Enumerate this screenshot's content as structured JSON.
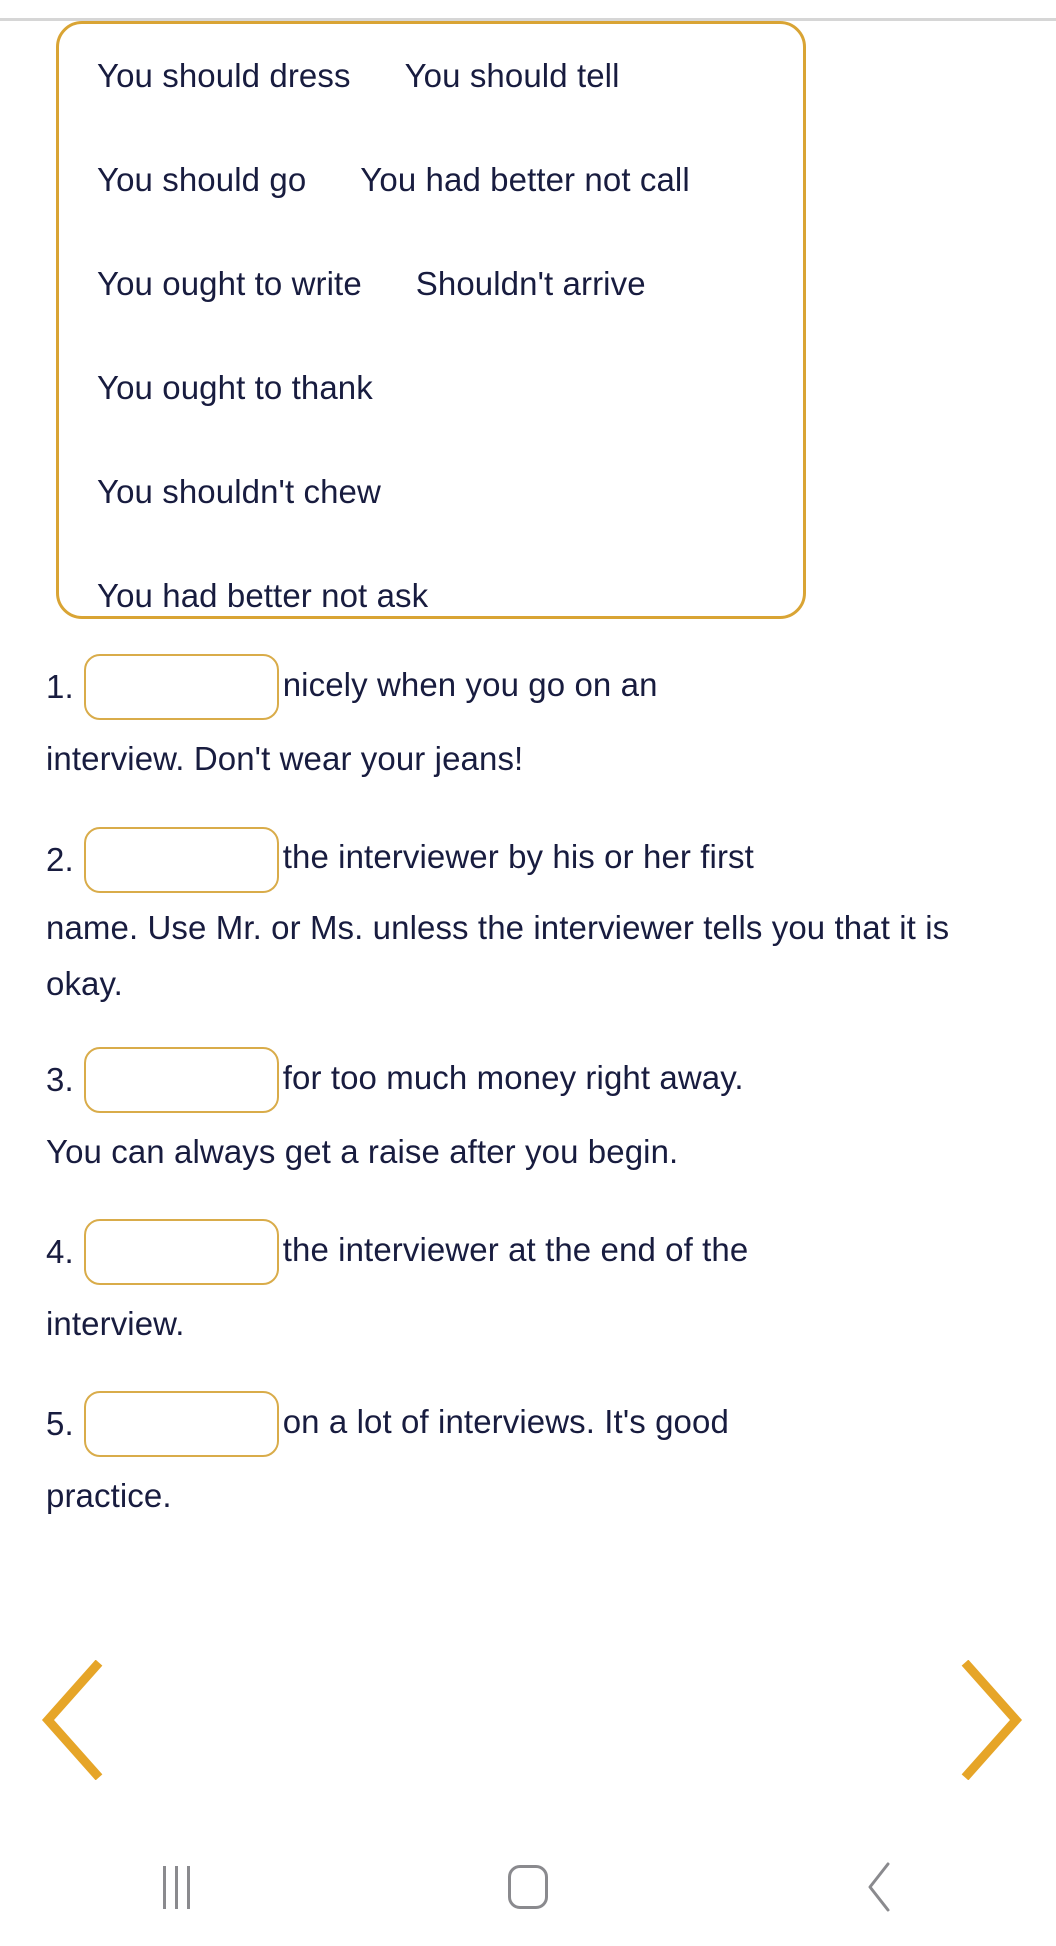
{
  "word_bank": {
    "rows": [
      [
        "You should dress",
        "You should tell"
      ],
      [
        "You should go",
        "You had better not call"
      ],
      [
        "You ought to write",
        "Shouldn't arrive"
      ],
      [
        "You ought to thank"
      ],
      [
        "You shouldn't chew"
      ],
      [
        "You had better not ask"
      ]
    ]
  },
  "questions": [
    {
      "number": "1.",
      "after_blank": "nicely when you go on an",
      "tail": "interview. Don't wear your jeans!",
      "blank_value": ""
    },
    {
      "number": "2.",
      "after_blank": "the interviewer by his or her first",
      "tail": "name. Use Mr. or Ms. unless the interviewer tells you that it is okay.",
      "blank_value": ""
    },
    {
      "number": "3.",
      "after_blank": "for too much money right away.",
      "tail": "You can always get a raise after you begin.",
      "blank_value": ""
    },
    {
      "number": "4.",
      "after_blank": "the interviewer at the end of the",
      "tail": "interview.",
      "blank_value": ""
    },
    {
      "number": "5.",
      "after_blank": "on a lot of interviews. It's good",
      "tail": "practice.",
      "blank_value": ""
    }
  ],
  "navigation": {
    "previous_label": "‹",
    "next_label": "›"
  },
  "system_nav": {
    "recents_label": "|||",
    "home_label": "○",
    "back_label": "‹"
  },
  "colors": {
    "accent": "#d9a434",
    "blank_border": "#d9ac4a",
    "text": "#181c3f",
    "divider": "#d6d6d6",
    "system_icon": "#8a8a8e"
  }
}
